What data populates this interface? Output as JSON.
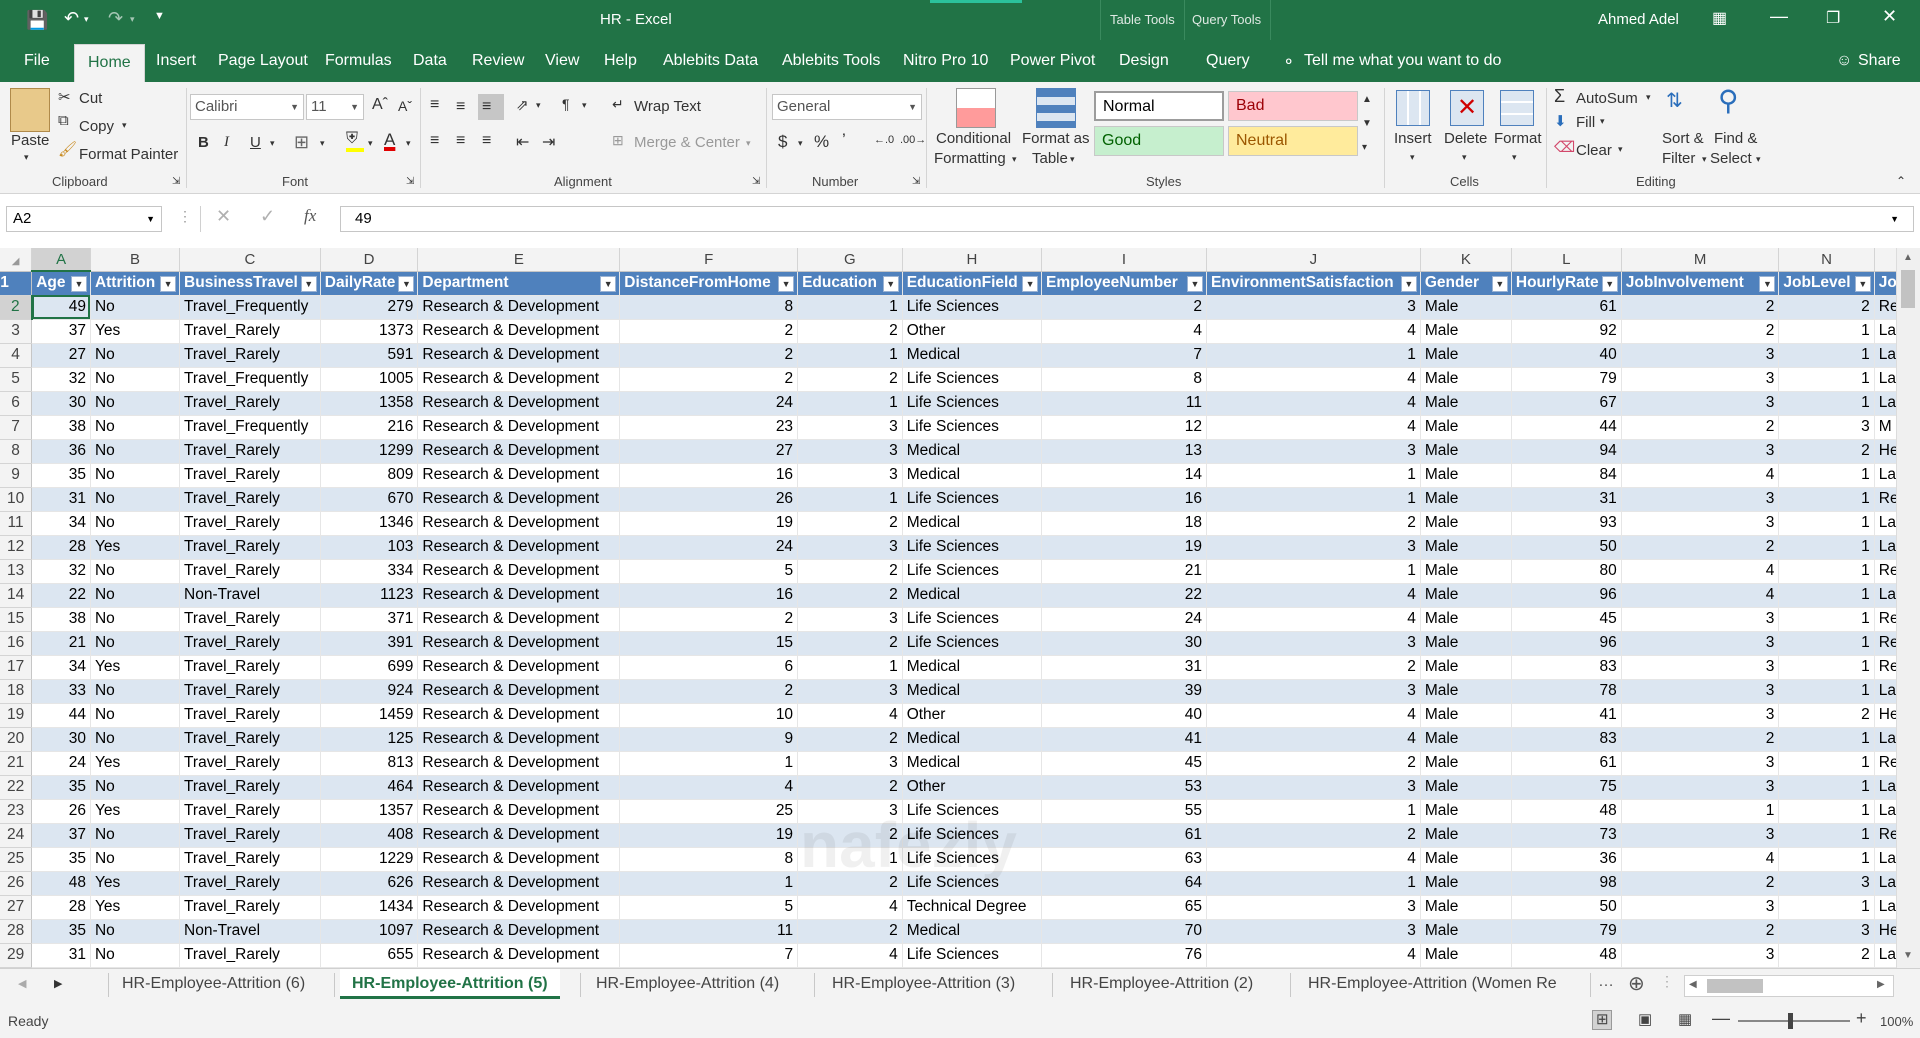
{
  "window": {
    "title": "HR  -  Excel",
    "context_tabs": [
      "Table Tools",
      "Query Tools"
    ],
    "user": "Ahmed Adel"
  },
  "ribbon_tabs": [
    "File",
    "Home",
    "Insert",
    "Page Layout",
    "Formulas",
    "Data",
    "Review",
    "View",
    "Help",
    "Ablebits Data",
    "Ablebits Tools",
    "Nitro Pro 10",
    "Power Pivot",
    "Design",
    "Query"
  ],
  "tell_me": "Tell me what you want to do",
  "share": "Share",
  "clipboard": {
    "paste": "Paste",
    "cut": "Cut",
    "copy": "Copy",
    "format_painter": "Format Painter",
    "label": "Clipboard"
  },
  "font": {
    "name": "Calibri",
    "size": "11",
    "label": "Font"
  },
  "alignment": {
    "wrap": "Wrap Text",
    "merge": "Merge & Center",
    "label": "Alignment"
  },
  "number": {
    "format": "General",
    "label": "Number"
  },
  "styles": {
    "conditional": "Conditional",
    "conditional2": "Formatting",
    "format_as": "Format as",
    "format_as2": "Table",
    "normal": "Normal",
    "bad": "Bad",
    "good": "Good",
    "neutral": "Neutral",
    "label": "Styles"
  },
  "cells": {
    "insert": "Insert",
    "delete": "Delete",
    "format": "Format",
    "label": "Cells"
  },
  "editing": {
    "autosum": "AutoSum",
    "fill": "Fill",
    "clear": "Clear",
    "sort": "Sort &",
    "sort2": "Filter",
    "find": "Find &",
    "find2": "Select",
    "label": "Editing"
  },
  "formula_bar": {
    "name_box": "A2",
    "value": "49",
    "fx": "fx"
  },
  "columns": [
    "A",
    "B",
    "C",
    "D",
    "E",
    "F",
    "G",
    "H",
    "I",
    "J",
    "K",
    "L",
    "M",
    "N",
    ""
  ],
  "headers": [
    "Age",
    "Attrition",
    "BusinessTravel",
    "DailyRate",
    "Department",
    "DistanceFromHome",
    "Education",
    "EducationField",
    "EmployeeNumber",
    "EnvironmentSatisfaction",
    "Gender",
    "HourlyRate",
    "JobInvolvement",
    "JobLevel",
    "Jo"
  ],
  "rows": [
    [
      "2",
      "49",
      "No",
      "Travel_Frequently",
      "279",
      "Research & Development",
      "8",
      "1",
      "Life Sciences",
      "2",
      "3",
      "Male",
      "61",
      "2",
      "2",
      "Re"
    ],
    [
      "3",
      "37",
      "Yes",
      "Travel_Rarely",
      "1373",
      "Research & Development",
      "2",
      "2",
      "Other",
      "4",
      "4",
      "Male",
      "92",
      "2",
      "1",
      "La"
    ],
    [
      "4",
      "27",
      "No",
      "Travel_Rarely",
      "591",
      "Research & Development",
      "2",
      "1",
      "Medical",
      "7",
      "1",
      "Male",
      "40",
      "3",
      "1",
      "La"
    ],
    [
      "5",
      "32",
      "No",
      "Travel_Frequently",
      "1005",
      "Research & Development",
      "2",
      "2",
      "Life Sciences",
      "8",
      "4",
      "Male",
      "79",
      "3",
      "1",
      "La"
    ],
    [
      "6",
      "30",
      "No",
      "Travel_Rarely",
      "1358",
      "Research & Development",
      "24",
      "1",
      "Life Sciences",
      "11",
      "4",
      "Male",
      "67",
      "3",
      "1",
      "La"
    ],
    [
      "7",
      "38",
      "No",
      "Travel_Frequently",
      "216",
      "Research & Development",
      "23",
      "3",
      "Life Sciences",
      "12",
      "4",
      "Male",
      "44",
      "2",
      "3",
      "M"
    ],
    [
      "8",
      "36",
      "No",
      "Travel_Rarely",
      "1299",
      "Research & Development",
      "27",
      "3",
      "Medical",
      "13",
      "3",
      "Male",
      "94",
      "3",
      "2",
      "He"
    ],
    [
      "9",
      "35",
      "No",
      "Travel_Rarely",
      "809",
      "Research & Development",
      "16",
      "3",
      "Medical",
      "14",
      "1",
      "Male",
      "84",
      "4",
      "1",
      "La"
    ],
    [
      "10",
      "31",
      "No",
      "Travel_Rarely",
      "670",
      "Research & Development",
      "26",
      "1",
      "Life Sciences",
      "16",
      "1",
      "Male",
      "31",
      "3",
      "1",
      "Re"
    ],
    [
      "11",
      "34",
      "No",
      "Travel_Rarely",
      "1346",
      "Research & Development",
      "19",
      "2",
      "Medical",
      "18",
      "2",
      "Male",
      "93",
      "3",
      "1",
      "La"
    ],
    [
      "12",
      "28",
      "Yes",
      "Travel_Rarely",
      "103",
      "Research & Development",
      "24",
      "3",
      "Life Sciences",
      "19",
      "3",
      "Male",
      "50",
      "2",
      "1",
      "La"
    ],
    [
      "13",
      "32",
      "No",
      "Travel_Rarely",
      "334",
      "Research & Development",
      "5",
      "2",
      "Life Sciences",
      "21",
      "1",
      "Male",
      "80",
      "4",
      "1",
      "Re"
    ],
    [
      "14",
      "22",
      "No",
      "Non-Travel",
      "1123",
      "Research & Development",
      "16",
      "2",
      "Medical",
      "22",
      "4",
      "Male",
      "96",
      "4",
      "1",
      "La"
    ],
    [
      "15",
      "38",
      "No",
      "Travel_Rarely",
      "371",
      "Research & Development",
      "2",
      "3",
      "Life Sciences",
      "24",
      "4",
      "Male",
      "45",
      "3",
      "1",
      "Re"
    ],
    [
      "16",
      "21",
      "No",
      "Travel_Rarely",
      "391",
      "Research & Development",
      "15",
      "2",
      "Life Sciences",
      "30",
      "3",
      "Male",
      "96",
      "3",
      "1",
      "Re"
    ],
    [
      "17",
      "34",
      "Yes",
      "Travel_Rarely",
      "699",
      "Research & Development",
      "6",
      "1",
      "Medical",
      "31",
      "2",
      "Male",
      "83",
      "3",
      "1",
      "Re"
    ],
    [
      "18",
      "33",
      "No",
      "Travel_Rarely",
      "924",
      "Research & Development",
      "2",
      "3",
      "Medical",
      "39",
      "3",
      "Male",
      "78",
      "3",
      "1",
      "La"
    ],
    [
      "19",
      "44",
      "No",
      "Travel_Rarely",
      "1459",
      "Research & Development",
      "10",
      "4",
      "Other",
      "40",
      "4",
      "Male",
      "41",
      "3",
      "2",
      "He"
    ],
    [
      "20",
      "30",
      "No",
      "Travel_Rarely",
      "125",
      "Research & Development",
      "9",
      "2",
      "Medical",
      "41",
      "4",
      "Male",
      "83",
      "2",
      "1",
      "La"
    ],
    [
      "21",
      "24",
      "Yes",
      "Travel_Rarely",
      "813",
      "Research & Development",
      "1",
      "3",
      "Medical",
      "45",
      "2",
      "Male",
      "61",
      "3",
      "1",
      "Re"
    ],
    [
      "22",
      "35",
      "No",
      "Travel_Rarely",
      "464",
      "Research & Development",
      "4",
      "2",
      "Other",
      "53",
      "3",
      "Male",
      "75",
      "3",
      "1",
      "La"
    ],
    [
      "23",
      "26",
      "Yes",
      "Travel_Rarely",
      "1357",
      "Research & Development",
      "25",
      "3",
      "Life Sciences",
      "55",
      "1",
      "Male",
      "48",
      "1",
      "1",
      "La"
    ],
    [
      "24",
      "37",
      "No",
      "Travel_Rarely",
      "408",
      "Research & Development",
      "19",
      "2",
      "Life Sciences",
      "61",
      "2",
      "Male",
      "73",
      "3",
      "1",
      "Re"
    ],
    [
      "25",
      "35",
      "No",
      "Travel_Rarely",
      "1229",
      "Research & Development",
      "8",
      "1",
      "Life Sciences",
      "63",
      "4",
      "Male",
      "36",
      "4",
      "1",
      "La"
    ],
    [
      "26",
      "48",
      "Yes",
      "Travel_Rarely",
      "626",
      "Research & Development",
      "1",
      "2",
      "Life Sciences",
      "64",
      "1",
      "Male",
      "98",
      "2",
      "3",
      "La"
    ],
    [
      "27",
      "28",
      "Yes",
      "Travel_Rarely",
      "1434",
      "Research & Development",
      "5",
      "4",
      "Technical Degree",
      "65",
      "3",
      "Male",
      "50",
      "3",
      "1",
      "La"
    ],
    [
      "28",
      "35",
      "No",
      "Non-Travel",
      "1097",
      "Research & Development",
      "11",
      "2",
      "Medical",
      "70",
      "3",
      "Male",
      "79",
      "2",
      "3",
      "He"
    ],
    [
      "29",
      "31",
      "No",
      "Travel_Rarely",
      "655",
      "Research & Development",
      "7",
      "4",
      "Life Sciences",
      "76",
      "4",
      "Male",
      "48",
      "3",
      "2",
      "La"
    ]
  ],
  "sheet_tabs": [
    "HR-Employee-Attrition (6)",
    "HR-Employee-Attrition (5)",
    "HR-Employee-Attrition (4)",
    "HR-Employee-Attrition (3)",
    "HR-Employee-Attrition (2)",
    "HR-Employee-Attrition (Women Re"
  ],
  "status": {
    "ready": "Ready",
    "zoom": "100%"
  },
  "colors": {
    "excel_green": "#217346",
    "table_header": "#4f81bd",
    "table_band": "#dce6f1"
  }
}
